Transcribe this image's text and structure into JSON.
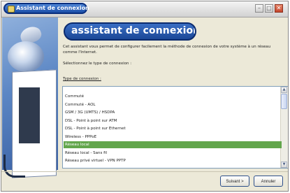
{
  "window": {
    "title": "Assistant de connexion"
  },
  "controls": {
    "minimize_glyph": "–",
    "maximize_glyph": "□",
    "close_glyph": "✕"
  },
  "header": {
    "title": "assistant de connexion"
  },
  "description": "Cet assistant vous permet de configurer facilement la méthode de connexion de votre système à un réseau comme l'Internet.",
  "select_prompt": "Sélectionnez le type de connexion :",
  "list": {
    "label": "Type de connexion :",
    "items": [
      "Commuté",
      "Commuté - AOL",
      "GSM / 3G (UMTS) / HSDPA",
      "DSL - Point à point sur ATM",
      "DSL - Point à point sur Ethernet",
      "Wireless - PPPoE",
      "Réseau local",
      "Réseau local - Sans fil",
      "Réseau privé virtuel - VPN PPTP"
    ],
    "selected_index": 6
  },
  "buttons": {
    "next": "Suivant >",
    "cancel": "Annuler"
  },
  "colors": {
    "accent": "#1b4797",
    "selection": "#62a64c"
  },
  "icons": {
    "window_icon": "network-connection-icon",
    "scroll_up": "arrow-up-icon",
    "scroll_down": "arrow-down-icon"
  }
}
